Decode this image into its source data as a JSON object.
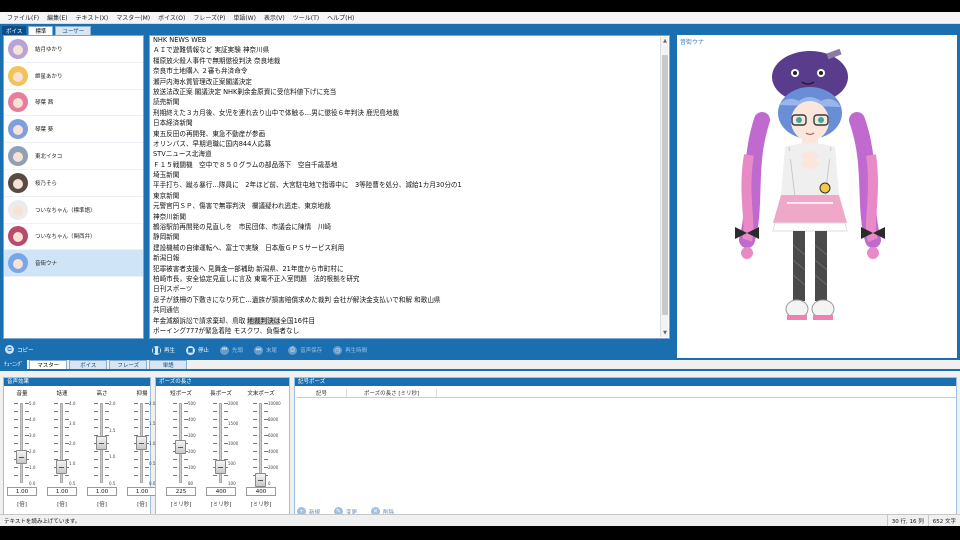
{
  "menu": [
    "ファイル(F)",
    "編集(E)",
    "テキスト(X)",
    "マスター(M)",
    "ボイス(O)",
    "フレーズ(P)",
    "単語(W)",
    "表示(V)",
    "ツール(T)",
    "ヘルプ(H)"
  ],
  "voice_panel": {
    "corner_label": "ボイス",
    "tabs": [
      "標準",
      "ユーザー"
    ],
    "items": [
      {
        "name": "結月ゆかり",
        "hair": "#b9a2d8",
        "selected": false
      },
      {
        "name": "紲星あかり",
        "hair": "#f2c35a",
        "selected": false
      },
      {
        "name": "琴葉 茜",
        "hair": "#e87e9c",
        "selected": false
      },
      {
        "name": "琴葉 葵",
        "hair": "#7f9fe0",
        "selected": false
      },
      {
        "name": "東北イタコ",
        "hair": "#8fa0b8",
        "selected": false
      },
      {
        "name": "桜乃そら",
        "hair": "#5a4a44",
        "selected": false
      },
      {
        "name": "ついなちゃん（標準語）",
        "hair": "#ececec",
        "selected": false
      },
      {
        "name": "ついなちゃん（関西弁）",
        "hair": "#b84a6a",
        "selected": false
      },
      {
        "name": "音街ウナ",
        "hair": "#7aa6e8",
        "selected": true
      }
    ],
    "copy_label": "コピー"
  },
  "text_panel": {
    "lines": [
      "NHK NEWS WEB",
      "ＡＩで遊難情報など 実証実験 神奈川県",
      "橿原放火殺人事件で無期懲役判決 奈良地裁",
      "奈良市土地購入 ２審も弁済命令",
      "瀬戸内海水質管理改正案閣議決定",
      "放送法改正案 閣議決定 NHK剰余金原資に受信料値下げに充当",
      "読売新聞",
      "刑期終えた３カ月後、女児を連れ去り山中で体触る…男に懲役６年判決 鹿児島地裁",
      "日本経済新聞",
      "東五反田の再開発、東急不動産が参画",
      "オリンパス、早期退職に国内844人応募",
      "STVニュース北海道",
      "Ｆ１５戦闘機　空中で８５０グラムの部品落下　空自千歳基地",
      "埼玉新聞",
      "平手打ち、蹴る暴行…隊員に　2年ほど前、大宮駐屯地で指導中に　3等陸曹を処分、減給1カ月30分の1",
      "東京新聞",
      "元警官円ＳＰ、傷害で無罪判決　欄議疑われ逃走、東京地裁",
      "神奈川新聞",
      "鶴浴駅前再開発の見直しを　市民団体、市議会に陳情　川崎",
      "静岡新聞",
      "建設機械の自律運転へ、富士で実験　日本版ＧＰＳサービス利用",
      "新潟日報",
      "犯罪被害者支援へ 見舞金一部補助 新潟県、21年度から市町村に",
      "柏崎市長，安全協定見直しに言及 東電不正入室問題　法的根拠を研究",
      "日刊スポーツ",
      "息子が鉄柵の下敷きになり死亡…遺族が損害賠償求めた裁判 会社が解決金支払いで和解 和歌山県",
      "共同通信",
      "年金減額訴訟で請求棄却、鳥取 地裁判決は全国16件目",
      "ボーイング777が緊急着陸 モスクワ、負傷者なし"
    ],
    "highlight_line": 27,
    "highlight_text": "地裁判決は"
  },
  "playback": [
    {
      "label": "再生",
      "icon": "pause-icon",
      "glyph": "❚❚",
      "enabled": true
    },
    {
      "label": "停止",
      "icon": "stop-icon",
      "glyph": "■",
      "enabled": true
    },
    {
      "label": "先頭",
      "icon": "skip-start-icon",
      "glyph": "⏮",
      "enabled": false
    },
    {
      "label": "末尾",
      "icon": "skip-end-icon",
      "glyph": "⏭",
      "enabled": false
    },
    {
      "label": "音声保存",
      "icon": "save-audio-icon",
      "glyph": "⎙",
      "enabled": false
    },
    {
      "label": "再生時間",
      "icon": "clock-icon",
      "glyph": "◷",
      "enabled": false
    }
  ],
  "character": {
    "name": "音街ウナ"
  },
  "bottom_tabs": {
    "corner": "ﾁｭｰﾆﾝｸﾞ",
    "tabs": [
      "マスター",
      "ボイス",
      "フレーズ",
      "単語"
    ],
    "active": 0
  },
  "effects": {
    "title": "音声効果",
    "sliders": [
      {
        "label": "音量",
        "value": "1.00",
        "unit": "[倍]",
        "level": 0.33,
        "scale": [
          "5.0",
          "4.0",
          "3.0",
          "2.0",
          "1.0",
          "0.0"
        ]
      },
      {
        "label": "話速",
        "value": "1.00",
        "unit": "[倍]",
        "level": 0.2,
        "scale": [
          "4.0",
          "3.0",
          "2.0",
          "1.0",
          "0.5"
        ]
      },
      {
        "label": "高さ",
        "value": "1.00",
        "unit": "[倍]",
        "level": 0.5,
        "scale": [
          "2.0",
          "1.5",
          "1.0",
          "0.5"
        ]
      },
      {
        "label": "抑揚",
        "value": "1.00",
        "unit": "[倍]",
        "level": 0.5,
        "scale": [
          "2.0",
          "1.5",
          "1.0",
          "0.5",
          "0.0"
        ]
      }
    ]
  },
  "pauses": {
    "title": "ポーズの長さ",
    "sliders": [
      {
        "label": "短ポーズ",
        "value": "225",
        "unit": "[ミリ秒]",
        "level": 0.45,
        "scale": [
          "500",
          "400",
          "300",
          "200",
          "100",
          "80"
        ]
      },
      {
        "label": "長ポーズ",
        "value": "400",
        "unit": "[ミリ秒]",
        "level": 0.2,
        "scale": [
          "2000",
          "1500",
          "1000",
          "500",
          "100"
        ]
      },
      {
        "label": "文末ポーズ",
        "value": "400",
        "unit": "[ミリ秒]",
        "level": 0.04,
        "scale": [
          "10000",
          "8000",
          "6000",
          "4000",
          "2000",
          "0"
        ]
      }
    ]
  },
  "symbol_pause": {
    "title": "記号ポーズ",
    "columns": [
      "記号",
      "ポーズの長さ [ミリ秒]"
    ],
    "buttons": [
      {
        "label": "新規",
        "icon": "new-icon",
        "glyph": "+"
      },
      {
        "label": "変更",
        "icon": "edit-icon",
        "glyph": "✎"
      },
      {
        "label": "削除",
        "icon": "delete-icon",
        "glyph": "✕"
      }
    ]
  },
  "status": {
    "message": "テキストを読み上げています。",
    "position": "30 行, 16 列",
    "chars": "652 文字"
  }
}
